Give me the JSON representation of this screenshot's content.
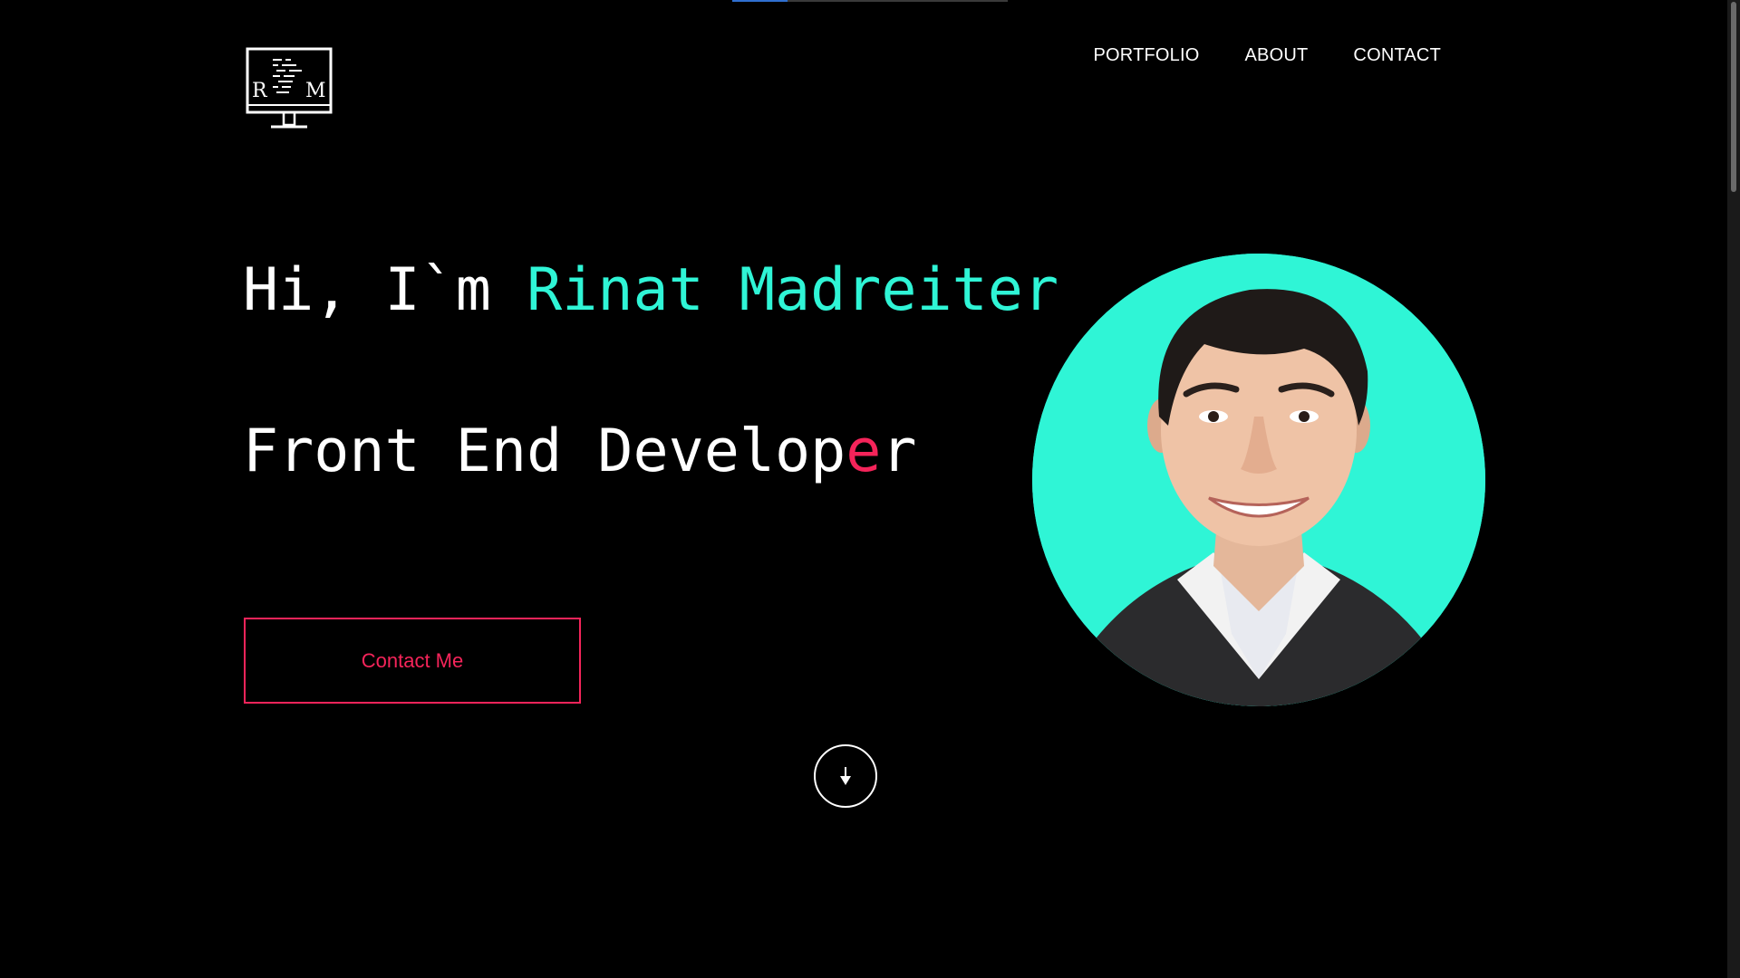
{
  "progress_bar": {
    "fill_fraction": 0.2,
    "fill_color": "#2f6fd0"
  },
  "logo": {
    "letter_left": "R",
    "letter_right": "M",
    "icon": "monitor-code-icon"
  },
  "nav": {
    "items": [
      {
        "label": "PORTFOLIO"
      },
      {
        "label": "ABOUT"
      },
      {
        "label": "CONTACT"
      }
    ]
  },
  "hero": {
    "greeting_prefix": "Hi, I`m ",
    "name": "Rinat Madreiter",
    "role_prefix": "Front End Develop",
    "role_cursor_char": "e",
    "role_suffix": "r"
  },
  "contact_button": {
    "label": "Contact Me"
  },
  "scroll_down": {
    "icon": "arrow-down-icon"
  },
  "avatar": {
    "icon": "profile-photo"
  },
  "colors": {
    "accent": "#2ff5d6",
    "cta": "#f5245a",
    "background": "#000000",
    "text": "#ffffff"
  }
}
